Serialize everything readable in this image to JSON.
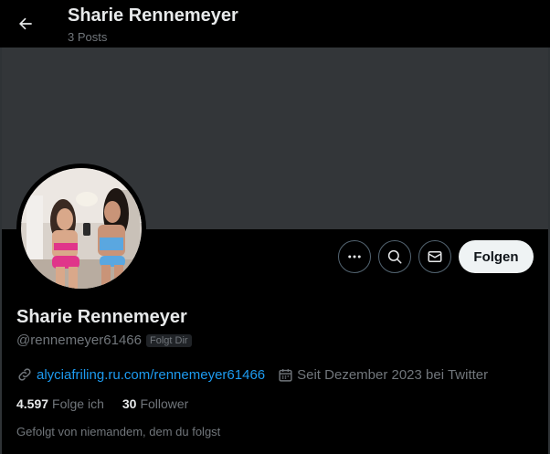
{
  "header": {
    "title": "Sharie Rennemeyer",
    "post_count": "3 Posts"
  },
  "profile": {
    "display_name": "Sharie Rennemeyer",
    "handle": "@rennemeyer61466",
    "follows_you_badge": "Folgt Dir",
    "website": "alyciafriling.ru.com/rennemeyer61466",
    "joined": "Seit Dezember 2023 bei Twitter",
    "following_count": "4.597",
    "following_label": "Folge ich",
    "followers_count": "30",
    "followers_label": "Follower",
    "followed_by": "Gefolgt von niemandem, dem du folgst"
  },
  "actions": {
    "more_icon": "more-icon",
    "search_icon": "search-icon",
    "message_icon": "envelope-icon",
    "follow_label": "Folgen"
  },
  "colors": {
    "background": "#000000",
    "banner": "#333639",
    "text_primary": "#e7e9ea",
    "text_secondary": "#71767b",
    "link": "#1d9bf0",
    "follow_button_bg": "#eff3f4"
  }
}
